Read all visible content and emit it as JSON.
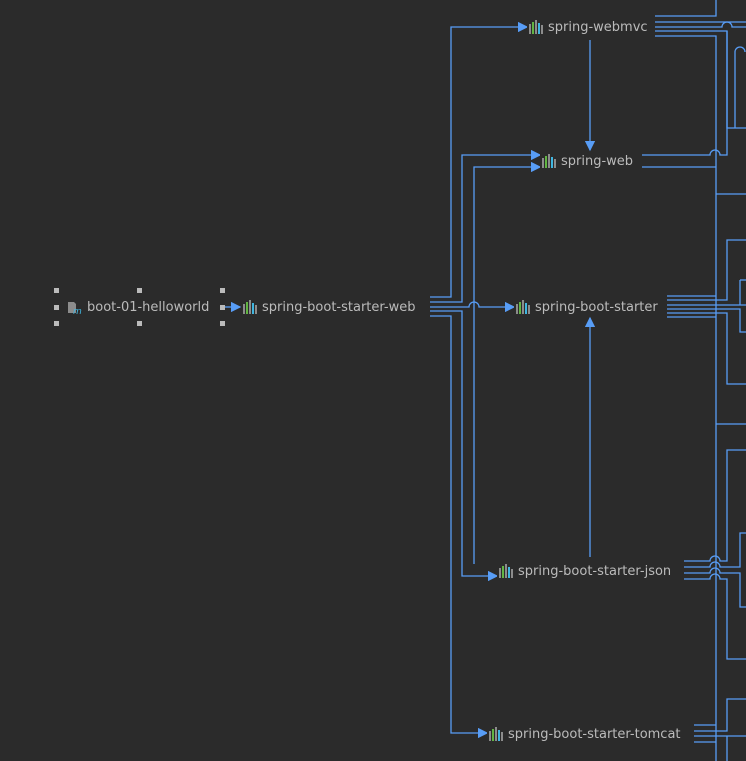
{
  "colors": {
    "background": "#2b2b2b",
    "edge": "#589df6",
    "text": "#bbbbbb",
    "lib_green": "#62b543",
    "lib_blue": "#40b6e0"
  },
  "nodes": {
    "root": {
      "label": "boot-01-helloworld",
      "icon": "maven-module-icon"
    },
    "starter_web": {
      "label": "spring-boot-starter-web",
      "icon": "library-icon"
    },
    "webmvc": {
      "label": "spring-webmvc",
      "icon": "library-icon"
    },
    "web": {
      "label": "spring-web",
      "icon": "library-icon"
    },
    "starter": {
      "label": "spring-boot-starter",
      "icon": "library-icon"
    },
    "json": {
      "label": "spring-boot-starter-json",
      "icon": "library-icon"
    },
    "tomcat": {
      "label": "spring-boot-starter-tomcat",
      "icon": "library-icon"
    }
  }
}
